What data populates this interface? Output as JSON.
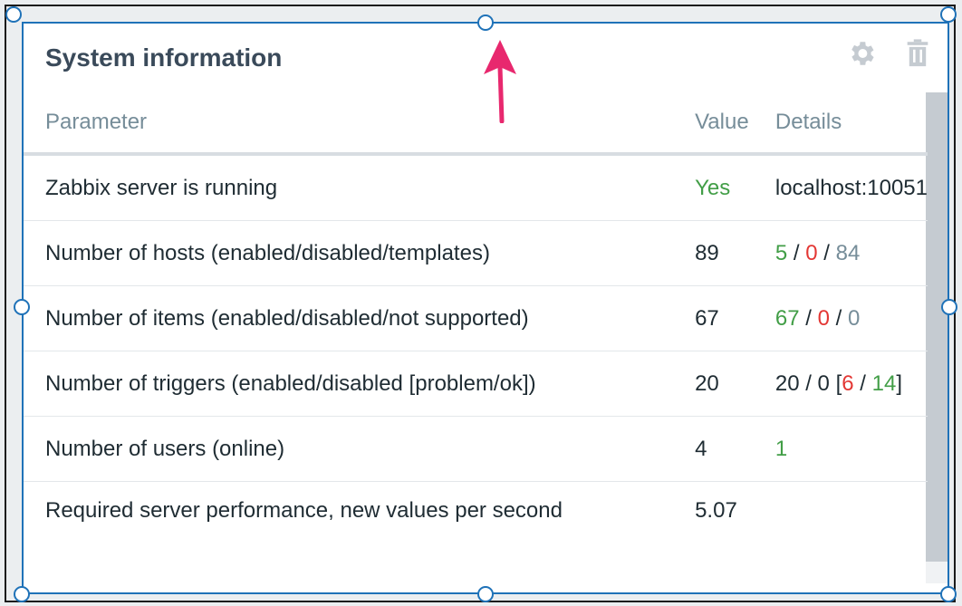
{
  "widget": {
    "title": "System information"
  },
  "icons": {
    "settings": "gear-icon",
    "delete": "trash-icon"
  },
  "table": {
    "headers": [
      "Parameter",
      "Value",
      "Details"
    ],
    "rows": [
      {
        "parameter": "Zabbix server is running",
        "value": "Yes",
        "details": [
          {
            "text": "localhost:10051",
            "color": "default"
          }
        ]
      },
      {
        "parameter": "Number of hosts (enabled/disabled/templates)",
        "value": "89",
        "details": [
          {
            "text": "5",
            "color": "green"
          },
          {
            "text": " / ",
            "color": "default"
          },
          {
            "text": "0",
            "color": "red"
          },
          {
            "text": " / ",
            "color": "default"
          },
          {
            "text": "84",
            "color": "grey"
          }
        ]
      },
      {
        "parameter": "Number of items (enabled/disabled/not supported)",
        "value": "67",
        "details": [
          {
            "text": "67",
            "color": "green"
          },
          {
            "text": " / ",
            "color": "default"
          },
          {
            "text": "0",
            "color": "red"
          },
          {
            "text": " / ",
            "color": "default"
          },
          {
            "text": "0",
            "color": "grey"
          }
        ]
      },
      {
        "parameter": "Number of triggers (enabled/disabled [problem/ok])",
        "value": "20",
        "details": [
          {
            "text": "20 / 0 [",
            "color": "default"
          },
          {
            "text": "6",
            "color": "red"
          },
          {
            "text": " / ",
            "color": "default"
          },
          {
            "text": "14",
            "color": "green"
          },
          {
            "text": "]",
            "color": "default"
          }
        ]
      },
      {
        "parameter": "Number of users (online)",
        "value": "4",
        "details": [
          {
            "text": "1",
            "color": "green"
          }
        ]
      },
      {
        "parameter": "Required server performance, new values per second",
        "value": "5.07",
        "details": []
      }
    ]
  },
  "colors": {
    "green": "#429e47",
    "red": "#e33734",
    "grey": "#768d99",
    "default": "#1f2c33",
    "selection_border": "#1f72b8",
    "arrow": "#e8286e"
  }
}
